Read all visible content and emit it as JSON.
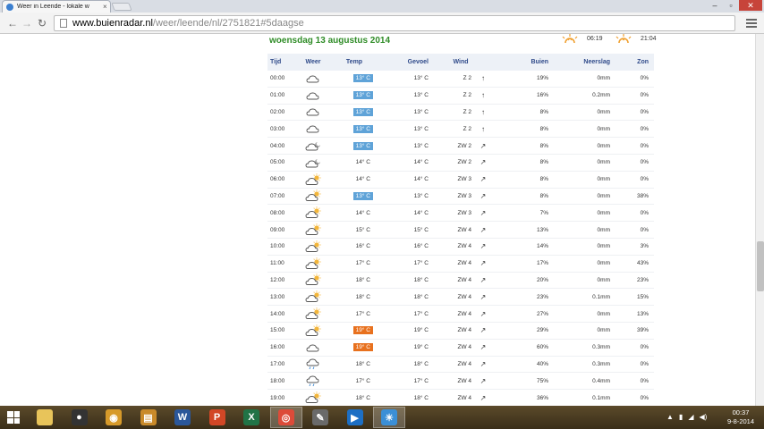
{
  "browser": {
    "tab_title": "Weer in Leende - lokale w",
    "url_host": "www.buienradar.nl",
    "url_path": "/weer/leende/nl/2751821#5daagse"
  },
  "page": {
    "date_heading": "woensdag 13 augustus 2014",
    "sunrise": "06:19",
    "sunset": "21:04"
  },
  "table": {
    "headers": {
      "tijd": "Tijd",
      "weer": "Weer",
      "temp": "Temp",
      "gevoel": "Gevoel",
      "wind": "Wind",
      "buien": "Buien",
      "neerslag": "Neerslag",
      "zon": "Zon"
    },
    "rows": [
      {
        "time": "00:00",
        "icon": "cloud-icon",
        "temp": "13° C",
        "temp_hl": "blue",
        "gevoel": "13° C",
        "wind": "Z 2",
        "arrow": "↑",
        "buien": "19%",
        "neerslag": "0mm",
        "zon": "0%"
      },
      {
        "time": "01:00",
        "icon": "cloud-icon",
        "temp": "13° C",
        "temp_hl": "blue",
        "gevoel": "13° C",
        "wind": "Z 2",
        "arrow": "↑",
        "buien": "16%",
        "neerslag": "0.2mm",
        "zon": "0%"
      },
      {
        "time": "02:00",
        "icon": "cloud-icon",
        "temp": "13° C",
        "temp_hl": "blue",
        "gevoel": "13° C",
        "wind": "Z 2",
        "arrow": "↑",
        "buien": "8%",
        "neerslag": "0mm",
        "zon": "0%"
      },
      {
        "time": "03:00",
        "icon": "cloud-icon",
        "temp": "13° C",
        "temp_hl": "blue",
        "gevoel": "13° C",
        "wind": "Z 2",
        "arrow": "↑",
        "buien": "8%",
        "neerslag": "0mm",
        "zon": "0%"
      },
      {
        "time": "04:00",
        "icon": "cloud-moon-icon",
        "temp": "13° C",
        "temp_hl": "blue",
        "gevoel": "13° C",
        "wind": "ZW 2",
        "arrow": "↗",
        "buien": "8%",
        "neerslag": "0mm",
        "zon": "0%"
      },
      {
        "time": "05:00",
        "icon": "cloud-moon-icon",
        "temp": "14° C",
        "temp_hl": "",
        "gevoel": "14° C",
        "wind": "ZW 2",
        "arrow": "↗",
        "buien": "8%",
        "neerslag": "0mm",
        "zon": "0%"
      },
      {
        "time": "06:00",
        "icon": "partly-sunny-icon",
        "temp": "14° C",
        "temp_hl": "",
        "gevoel": "14° C",
        "wind": "ZW 3",
        "arrow": "↗",
        "buien": "8%",
        "neerslag": "0mm",
        "zon": "0%"
      },
      {
        "time": "07:00",
        "icon": "partly-sunny-icon",
        "temp": "13° C",
        "temp_hl": "blue",
        "gevoel": "13° C",
        "wind": "ZW 3",
        "arrow": "↗",
        "buien": "8%",
        "neerslag": "0mm",
        "zon": "38%"
      },
      {
        "time": "08:00",
        "icon": "partly-sunny-icon",
        "temp": "14° C",
        "temp_hl": "",
        "gevoel": "14° C",
        "wind": "ZW 3",
        "arrow": "↗",
        "buien": "7%",
        "neerslag": "0mm",
        "zon": "0%"
      },
      {
        "time": "09:00",
        "icon": "partly-sunny-icon",
        "temp": "15° C",
        "temp_hl": "",
        "gevoel": "15° C",
        "wind": "ZW 4",
        "arrow": "↗",
        "buien": "13%",
        "neerslag": "0mm",
        "zon": "0%"
      },
      {
        "time": "10:00",
        "icon": "partly-sunny-icon",
        "temp": "16° C",
        "temp_hl": "",
        "gevoel": "16° C",
        "wind": "ZW 4",
        "arrow": "↗",
        "buien": "14%",
        "neerslag": "0mm",
        "zon": "3%"
      },
      {
        "time": "11:00",
        "icon": "partly-sunny-icon",
        "temp": "17° C",
        "temp_hl": "",
        "gevoel": "17° C",
        "wind": "ZW 4",
        "arrow": "↗",
        "buien": "17%",
        "neerslag": "0mm",
        "zon": "43%"
      },
      {
        "time": "12:00",
        "icon": "partly-sunny-icon",
        "temp": "18° C",
        "temp_hl": "",
        "gevoel": "18° C",
        "wind": "ZW 4",
        "arrow": "↗",
        "buien": "20%",
        "neerslag": "0mm",
        "zon": "23%"
      },
      {
        "time": "13:00",
        "icon": "partly-sunny-icon",
        "temp": "18° C",
        "temp_hl": "",
        "gevoel": "18° C",
        "wind": "ZW 4",
        "arrow": "↗",
        "buien": "23%",
        "neerslag": "0.1mm",
        "zon": "15%"
      },
      {
        "time": "14:00",
        "icon": "partly-sunny-icon",
        "temp": "17° C",
        "temp_hl": "",
        "gevoel": "17° C",
        "wind": "ZW 4",
        "arrow": "↗",
        "buien": "27%",
        "neerslag": "0mm",
        "zon": "13%"
      },
      {
        "time": "15:00",
        "icon": "partly-sunny-icon",
        "temp": "19° C",
        "temp_hl": "orange",
        "gevoel": "19° C",
        "wind": "ZW 4",
        "arrow": "↗",
        "buien": "29%",
        "neerslag": "0mm",
        "zon": "39%"
      },
      {
        "time": "16:00",
        "icon": "cloud-icon",
        "temp": "19° C",
        "temp_hl": "orange",
        "gevoel": "19° C",
        "wind": "ZW 4",
        "arrow": "↗",
        "buien": "60%",
        "neerslag": "0.3mm",
        "zon": "0%"
      },
      {
        "time": "17:00",
        "icon": "cloud-rain-icon",
        "temp": "18° C",
        "temp_hl": "",
        "gevoel": "18° C",
        "wind": "ZW 4",
        "arrow": "↗",
        "buien": "40%",
        "neerslag": "0.3mm",
        "zon": "0%"
      },
      {
        "time": "18:00",
        "icon": "cloud-rain-icon",
        "temp": "17° C",
        "temp_hl": "",
        "gevoel": "17° C",
        "wind": "ZW 4",
        "arrow": "↗",
        "buien": "75%",
        "neerslag": "0.4mm",
        "zon": "0%"
      },
      {
        "time": "19:00",
        "icon": "partly-sunny-icon",
        "temp": "18° C",
        "temp_hl": "",
        "gevoel": "18° C",
        "wind": "ZW 4",
        "arrow": "↗",
        "buien": "36%",
        "neerslag": "0.1mm",
        "zon": "0%"
      }
    ]
  },
  "colors": {
    "heading_green": "#2f8c27",
    "header_blue": "#2f4a8a",
    "temp_blue": "#5fa3d8",
    "temp_orange": "#e8711e",
    "sun_orange": "#f0a030"
  },
  "taskbar": {
    "apps": [
      "file-explorer-icon",
      "media-player-icon",
      "camera-app-icon",
      "archive-icon",
      "word-icon",
      "powerpoint-icon",
      "excel-icon",
      "chrome-icon",
      "photo-editor-icon",
      "video-player-icon",
      "weather-app-icon"
    ],
    "clock_time": "00:37",
    "clock_date": "9-8-2014"
  }
}
